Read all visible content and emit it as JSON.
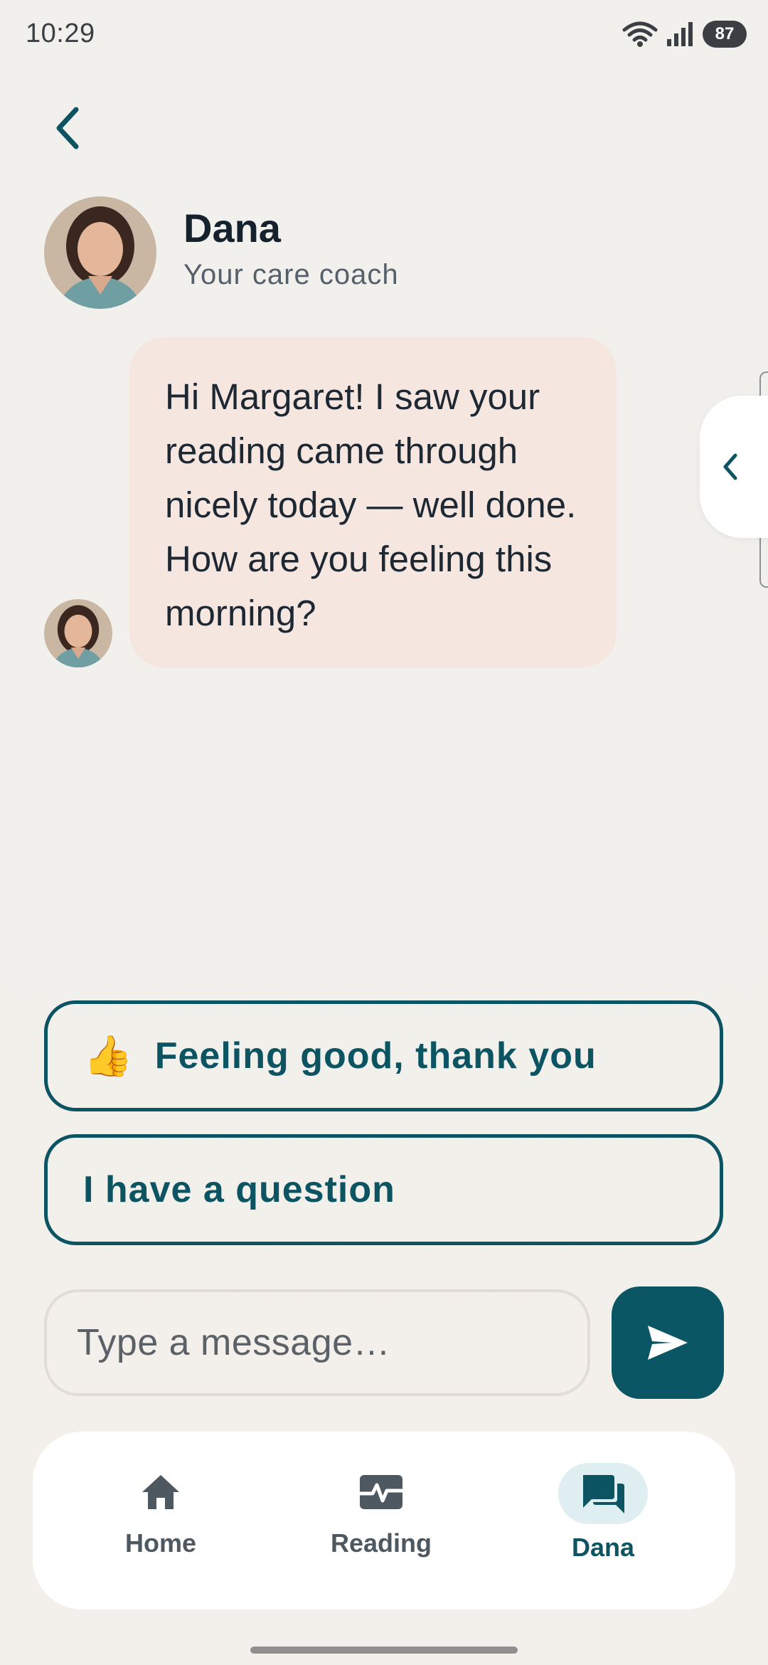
{
  "status_bar": {
    "time": "10:29",
    "battery": "87",
    "icons": [
      "wifi-icon",
      "signal-icon",
      "battery-icon"
    ]
  },
  "header": {
    "back_icon": "chevron-left-icon",
    "coach_name": "Dana",
    "coach_role": "Your care coach"
  },
  "messages": [
    {
      "sender": "Dana",
      "text": "Hi Margaret! I saw your reading came through nicely today — well done. How are you feeling this morning?"
    }
  ],
  "quick_replies": [
    {
      "emoji": "👍",
      "label": "Feeling good, thank you"
    },
    {
      "label": "I have a question"
    }
  ],
  "composer": {
    "placeholder": "Type a message…",
    "send_icon": "send-icon"
  },
  "nav": [
    {
      "label": "Home",
      "icon": "home-icon",
      "active": false
    },
    {
      "label": "Reading",
      "icon": "pulse-icon",
      "active": false
    },
    {
      "label": "Dana",
      "icon": "chat-icon",
      "active": true
    }
  ],
  "colors": {
    "accent": "#0c5462",
    "bubble": "#f6e6e0",
    "background": "#f1f0ed",
    "nav_active_bg": "#dfeef0"
  }
}
